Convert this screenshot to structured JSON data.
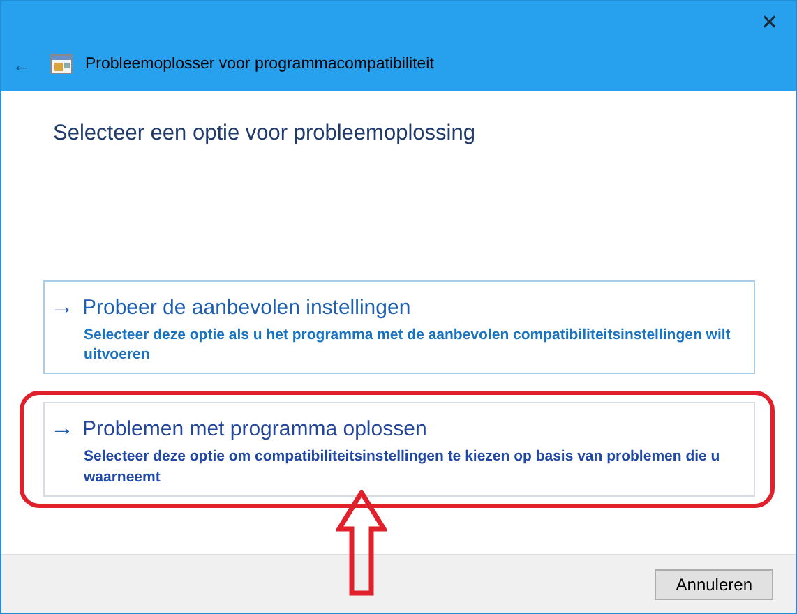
{
  "window": {
    "title": "Probleemoplosser voor programmacompatibiliteit",
    "close": "✕",
    "back": "←"
  },
  "heading": "Selecteer een optie voor probleemoplossing",
  "options": [
    {
      "arrow": "→",
      "title": "Probeer de aanbevolen instellingen",
      "description": "Selecteer deze optie als u het programma met de aanbevolen compatibiliteitsinstellingen wilt uitvoeren",
      "highlighted": false
    },
    {
      "arrow": "→",
      "title": "Problemen met programma oplossen",
      "description": "Selecteer deze optie om compatibiliteitsinstellingen te kiezen op basis van problemen die u waarneemt",
      "highlighted": true
    }
  ],
  "buttons": [
    "Annuleren"
  ]
}
